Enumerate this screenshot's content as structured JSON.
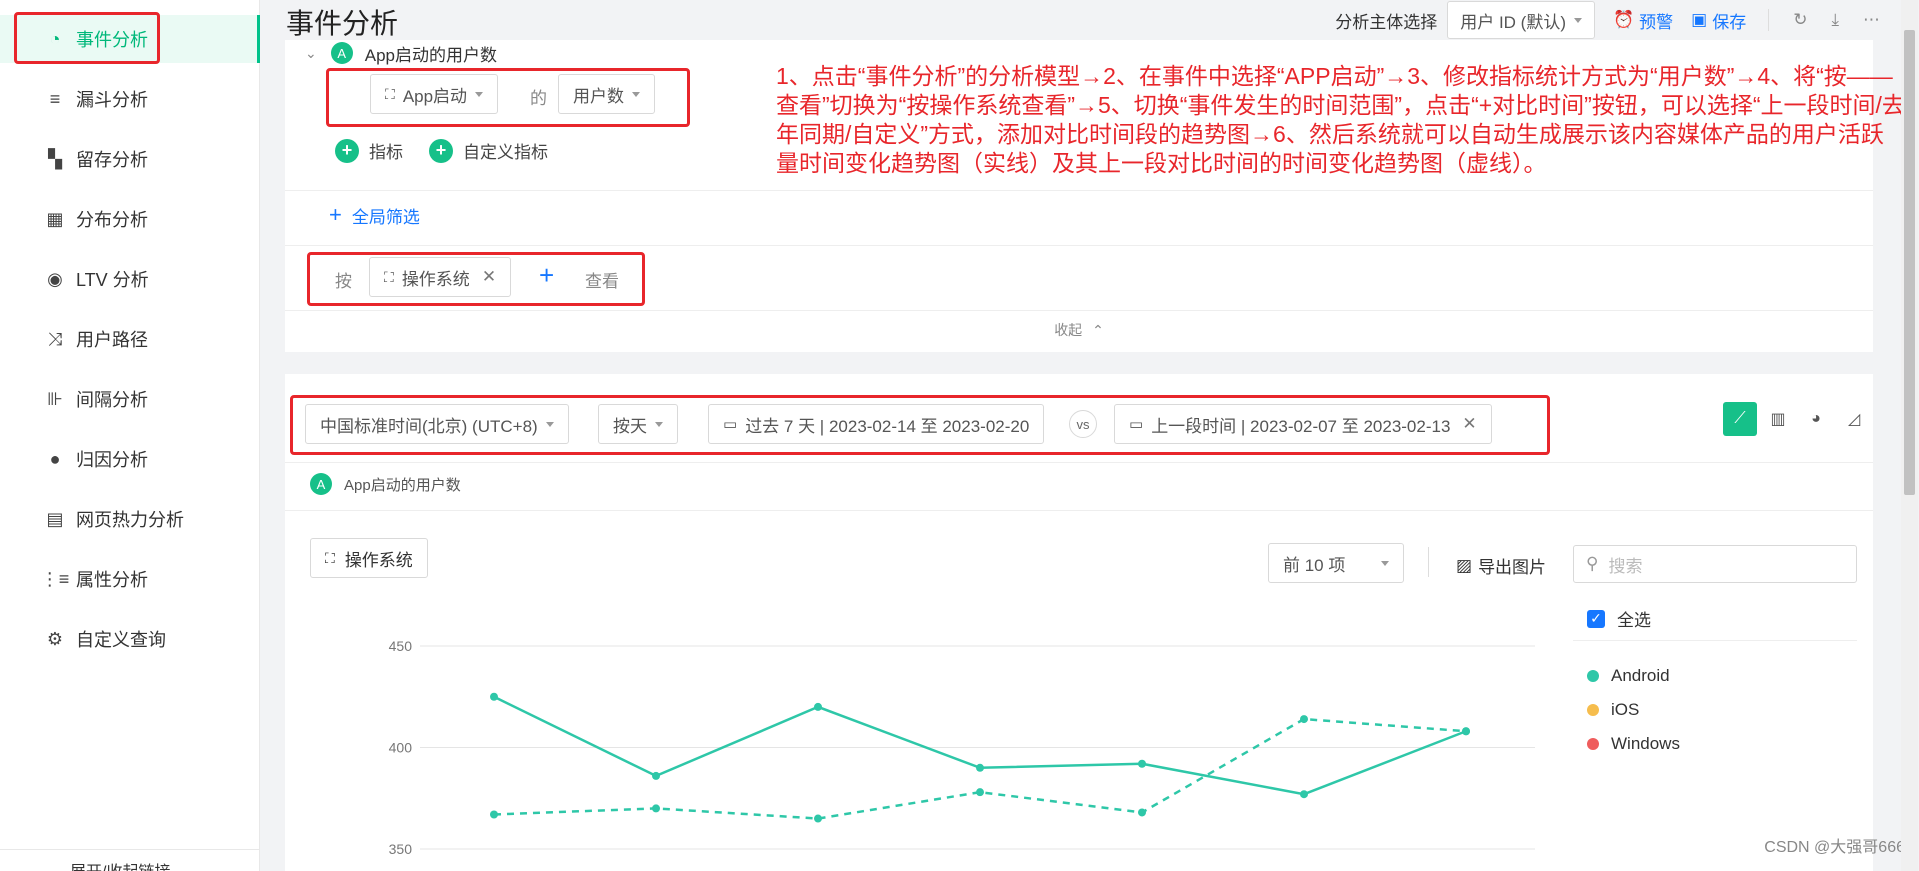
{
  "sidebar": {
    "items": [
      {
        "label": "事件分析",
        "icon": "event-analysis-icon",
        "active": true
      },
      {
        "label": "漏斗分析",
        "icon": "funnel-icon"
      },
      {
        "label": "留存分析",
        "icon": "retention-icon"
      },
      {
        "label": "分布分析",
        "icon": "distribution-icon"
      },
      {
        "label": "LTV 分析",
        "icon": "ltv-icon"
      },
      {
        "label": "用户路径",
        "icon": "user-path-icon"
      },
      {
        "label": "间隔分析",
        "icon": "interval-icon"
      },
      {
        "label": "归因分析",
        "icon": "attribution-icon"
      },
      {
        "label": "网页热力分析",
        "icon": "heatmap-icon"
      },
      {
        "label": "属性分析",
        "icon": "attribute-icon"
      },
      {
        "label": "自定义查询",
        "icon": "custom-query-icon"
      }
    ],
    "bottom_label": "展开/收起链接"
  },
  "header": {
    "title": "事件分析",
    "subject_label": "分析主体选择",
    "subject_value": "用户 ID (默认)",
    "alert_label": "预警",
    "save_label": "保存"
  },
  "metric": {
    "badge": "A",
    "name": "App启动的用户数",
    "event": "App启动",
    "connector": "的",
    "measure": "用户数",
    "add_metric": "指标",
    "add_custom_metric": "自定义指标"
  },
  "global_filter": "全局筛选",
  "groupby": {
    "prefix": "按",
    "dimension": "操作系统",
    "suffix": "查看"
  },
  "collapse_label": "收起",
  "time_controls": {
    "timezone": "中国标准时间(北京) (UTC+8)",
    "granularity": "按天",
    "range": "过去 7 天 | 2023-02-14 至 2023-02-20",
    "vs": "vs",
    "compare_range": "上一段时间 | 2023-02-07 至 2023-02-13"
  },
  "result": {
    "badge": "A",
    "name": "App启动的用户数",
    "dimension_button": "操作系统",
    "topn": "前 10 项",
    "export": "导出图片",
    "search_placeholder": "搜索",
    "select_all": "全选"
  },
  "legend": [
    {
      "name": "Android",
      "color": "#2ec7a8"
    },
    {
      "name": "iOS",
      "color": "#f6bd4d"
    },
    {
      "name": "Windows",
      "color": "#ef5d5d"
    }
  ],
  "annotation": "1、点击“事件分析”的分析模型→2、在事件中选择“APP启动”→3、修改指标统计方式为“用户数”→4、将“按——查看”切换为“按操作系统查看”→5、切换“事件发生的时间范围”，点击“+对比时间”按钮，可以选择“上一段时间/去年同期/自定义”方式，添加对比时间段的趋势图→6、然后系统就可以自动生成展示该内容媒体产品的用户活跃量时间变化趋势图（实线）及其上一段对比时间的时间变化趋势图（虚线）。",
  "watermark": "CSDN @大强哥666",
  "chart_data": {
    "type": "line",
    "x": [
      1,
      2,
      3,
      4,
      5,
      6,
      7
    ],
    "yticks": [
      350,
      400,
      450
    ],
    "ylim": [
      350,
      450
    ],
    "series": [
      {
        "name": "Android",
        "style": "solid",
        "color": "#2ec7a8",
        "values": [
          425,
          386,
          420,
          390,
          392,
          377,
          408
        ]
      },
      {
        "style": "dashed",
        "color": "#2ec7a8",
        "values": [
          367,
          370,
          365,
          378,
          368,
          414,
          408
        ]
      }
    ]
  }
}
